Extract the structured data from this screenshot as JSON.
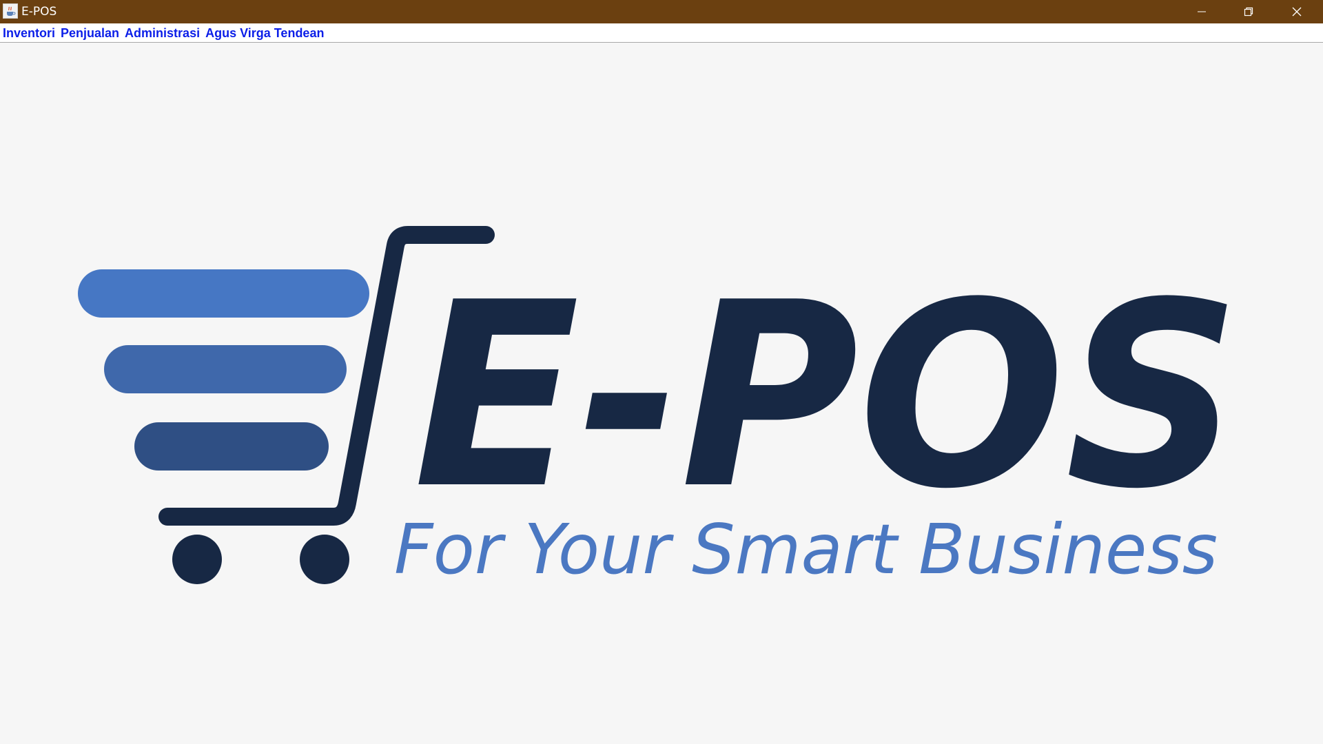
{
  "window": {
    "title": "E-POS",
    "icon": "java-cup-icon",
    "controls": {
      "minimize": "minimize-icon",
      "restore": "restore-icon",
      "close": "close-icon"
    },
    "titlebar_color": "#6b4010"
  },
  "menubar": {
    "items": [
      {
        "label": "Inventori"
      },
      {
        "label": "Penjualan"
      },
      {
        "label": "Administrasi"
      },
      {
        "label": "Agus Virga Tendean"
      }
    ],
    "text_color": "#0b1ee8"
  },
  "logo": {
    "wordmark": "E-POS",
    "tagline": "For Your Smart Business",
    "icon": "shopping-cart-icon",
    "colors": {
      "dark_navy": "#172844",
      "bar_1": "#4677c4",
      "bar_2": "#3f68ab",
      "bar_3": "#2f4f84",
      "tagline": "#4b78c2"
    }
  }
}
